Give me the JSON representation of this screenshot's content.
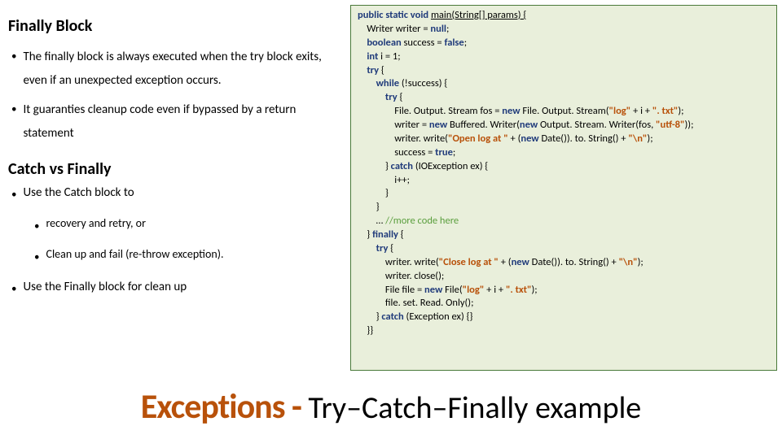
{
  "left": {
    "heading1": "Finally Block",
    "bullets1": [
      "The finally block is always executed when the try block exits, even if an unexpected exception occurs.",
      "It guaranties cleanup code even if bypassed by a return statement"
    ],
    "heading2": "Catch vs Finally",
    "bullets2a": "Use the Catch block to",
    "bullets2a_sub": [
      "recovery and retry, or",
      "Clean up and fail (re-throw exception)."
    ],
    "bullets2b": "Use the Finally block for clean up"
  },
  "code": {
    "l01a": "public static void ",
    "l01b": "main(String[] params) {",
    "l02a": "    Writer writer = ",
    "l02b": "null",
    "l02c": ";",
    "l03a": "    ",
    "l03b": "boolean ",
    "l03c": "success = ",
    "l03d": "false",
    "l03e": ";",
    "l04a": "    ",
    "l04b": "int ",
    "l04c": "i = 1;",
    "l05a": "    ",
    "l05b": "try ",
    "l05c": "{",
    "l06a": "        ",
    "l06b": "while ",
    "l06c": "(!success) {",
    "l07a": "            ",
    "l07b": "try ",
    "l07c": "{",
    "l08a": "                File. Output. Stream fos = ",
    "l08b": "new ",
    "l08c": "File. Output. Stream(",
    "l08d": "\"log\" ",
    "l08e": "+ i + ",
    "l08f": "\". txt\"",
    "l08g": ");",
    "l09a": "                writer = ",
    "l09b": "new ",
    "l09c": "Buffered. Writer(",
    "l09d": "new ",
    "l09e": "Output. Stream. Writer(fos, ",
    "l09f": "\"utf-8\"",
    "l09g": "));",
    "l10a": "                writer. write(",
    "l10b": "\"Open log at \" ",
    "l10c": "+ (",
    "l10d": "new ",
    "l10e": "Date()). to. String() + ",
    "l10f": "\"\\n\"",
    "l10g": ");",
    "l11a": "                success = ",
    "l11b": "true",
    "l11c": ";",
    "l12a": "            } ",
    "l12b": "catch ",
    "l12c": "(IOException ex) {",
    "l13": "                i++;",
    "l14": "            }",
    "l15": "        }",
    "l16a": "        … ",
    "l16b": "//more code here",
    "l17a": "    } ",
    "l17b": "finally ",
    "l17c": "{",
    "l18a": "        ",
    "l18b": "try ",
    "l18c": "{",
    "l19a": "            writer. write(",
    "l19b": "\"Close log at \" ",
    "l19c": "+ (",
    "l19d": "new ",
    "l19e": "Date()). to. String() + ",
    "l19f": "\"\\n\"",
    "l19g": ");",
    "l20": "            writer. close();",
    "l21a": "            File file = ",
    "l21b": "new ",
    "l21c": "File(",
    "l21d": "\"log\" ",
    "l21e": "+ i + ",
    "l21f": "\". txt\"",
    "l21g": ");",
    "l22": "            file. set. Read. Only();",
    "l23a": "        } ",
    "l23b": "catch ",
    "l23c": "(Exception ex) {}",
    "l24": "    }}"
  },
  "title": {
    "red": "Exceptions - ",
    "black": "Try–Catch–Finally example"
  }
}
